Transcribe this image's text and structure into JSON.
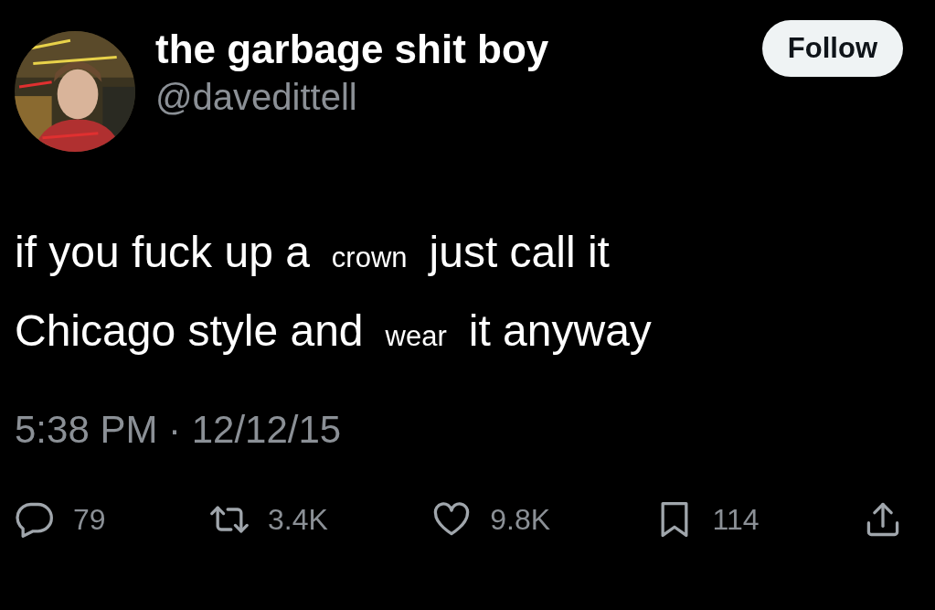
{
  "author": {
    "name": "the garbage shit boy",
    "handle": "@davedittell"
  },
  "follow_button": "Follow",
  "body": [
    [
      {
        "text": "if you fuck up a",
        "kind": "normal"
      },
      {
        "text": "crown",
        "kind": "small"
      },
      {
        "text": "just call it",
        "kind": "normal"
      }
    ],
    [
      {
        "text": "Chicago style and",
        "kind": "normal"
      },
      {
        "text": "wear",
        "kind": "small"
      },
      {
        "text": "it anyway",
        "kind": "normal"
      }
    ]
  ],
  "timestamp": "5:38 PM · 12/12/15",
  "actions": [
    {
      "kind": "reply",
      "count": "79"
    },
    {
      "kind": "repost",
      "count": "3.4K"
    },
    {
      "kind": "like",
      "count": "9.8K"
    },
    {
      "kind": "bookmark",
      "count": "114"
    },
    {
      "kind": "share"
    }
  ]
}
